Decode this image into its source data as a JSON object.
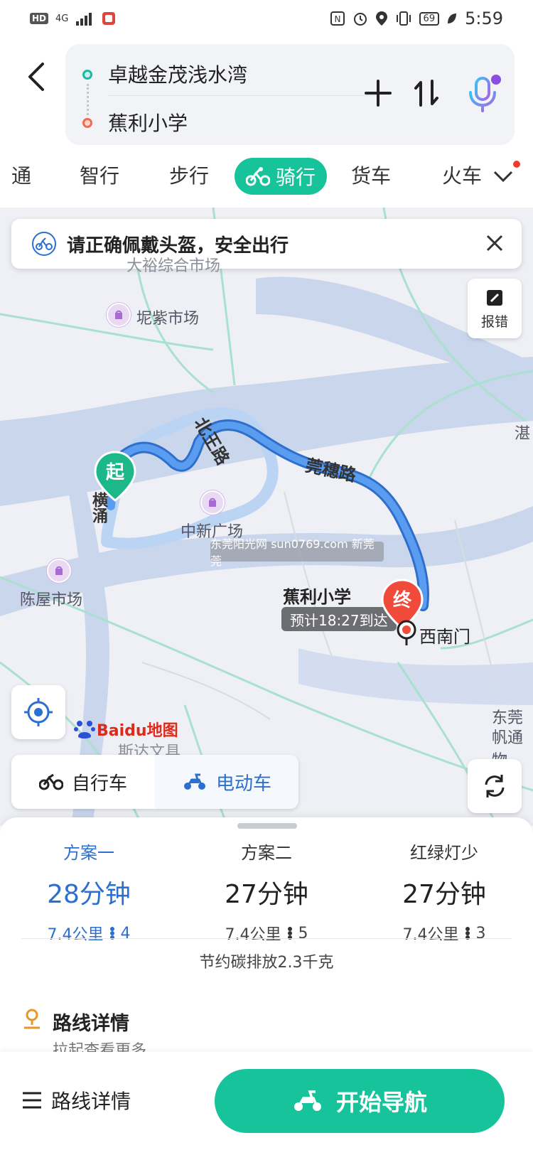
{
  "status_bar": {
    "network": "4G",
    "hd": "HD",
    "battery": "69",
    "time": "5:59"
  },
  "header": {
    "start_location": "卓越金茂浅水湾",
    "end_location": "蕉利小学"
  },
  "tabs": [
    {
      "label": "通"
    },
    {
      "label": "智行"
    },
    {
      "label": "步行"
    },
    {
      "label": "骑行",
      "active": true
    },
    {
      "label": "货车"
    },
    {
      "label": "火车"
    }
  ],
  "map": {
    "notice": "请正确佩戴头盔，安全出行",
    "report_label": "报错",
    "labels": {
      "market_top": "大裕综合市场",
      "market_ni": "坭紫市场",
      "road_beiwang": "北王路",
      "road_guansui": "莞穗路",
      "road_heng": "横涌",
      "mall": "中新广场",
      "market_chen": "陈屋市场",
      "edge_zhan": "湛",
      "edge_dong": "东莞",
      "edge_fan": "帆通物",
      "bottom_text": "斯达文具"
    },
    "start_pin": "起",
    "end_pin": "终",
    "destination_label": "蕉利小学",
    "eta": "预计18:27到达",
    "gate_label": "西南门",
    "watermark": "东莞阳光网 sun0769.com 新莞莞",
    "logo_text": "Baidu地图",
    "vehicles": [
      {
        "label": "自行车",
        "active": false
      },
      {
        "label": "电动车",
        "active": true
      }
    ]
  },
  "plans": [
    {
      "name": "方案一",
      "time": "28分钟",
      "distance": "7.4公里",
      "lights": "4",
      "active": true
    },
    {
      "name": "方案二",
      "time": "27分钟",
      "distance": "7.4公里",
      "lights": "5",
      "active": false
    },
    {
      "name": "红绿灯少",
      "time": "27分钟",
      "distance": "7.4公里",
      "lights": "3",
      "active": false
    }
  ],
  "carbon_saving": "节约碳排放2.3千克",
  "route_detail": {
    "title": "路线详情",
    "subtitle": "拉起查看更多"
  },
  "bottom_bar": {
    "menu_label": "路线详情",
    "start_button": "开始导航"
  },
  "colors": {
    "accent": "#17c39a",
    "route_blue": "#3a84e6",
    "plan_active": "#2b6fd1",
    "end_pin": "#ef4a3a"
  }
}
